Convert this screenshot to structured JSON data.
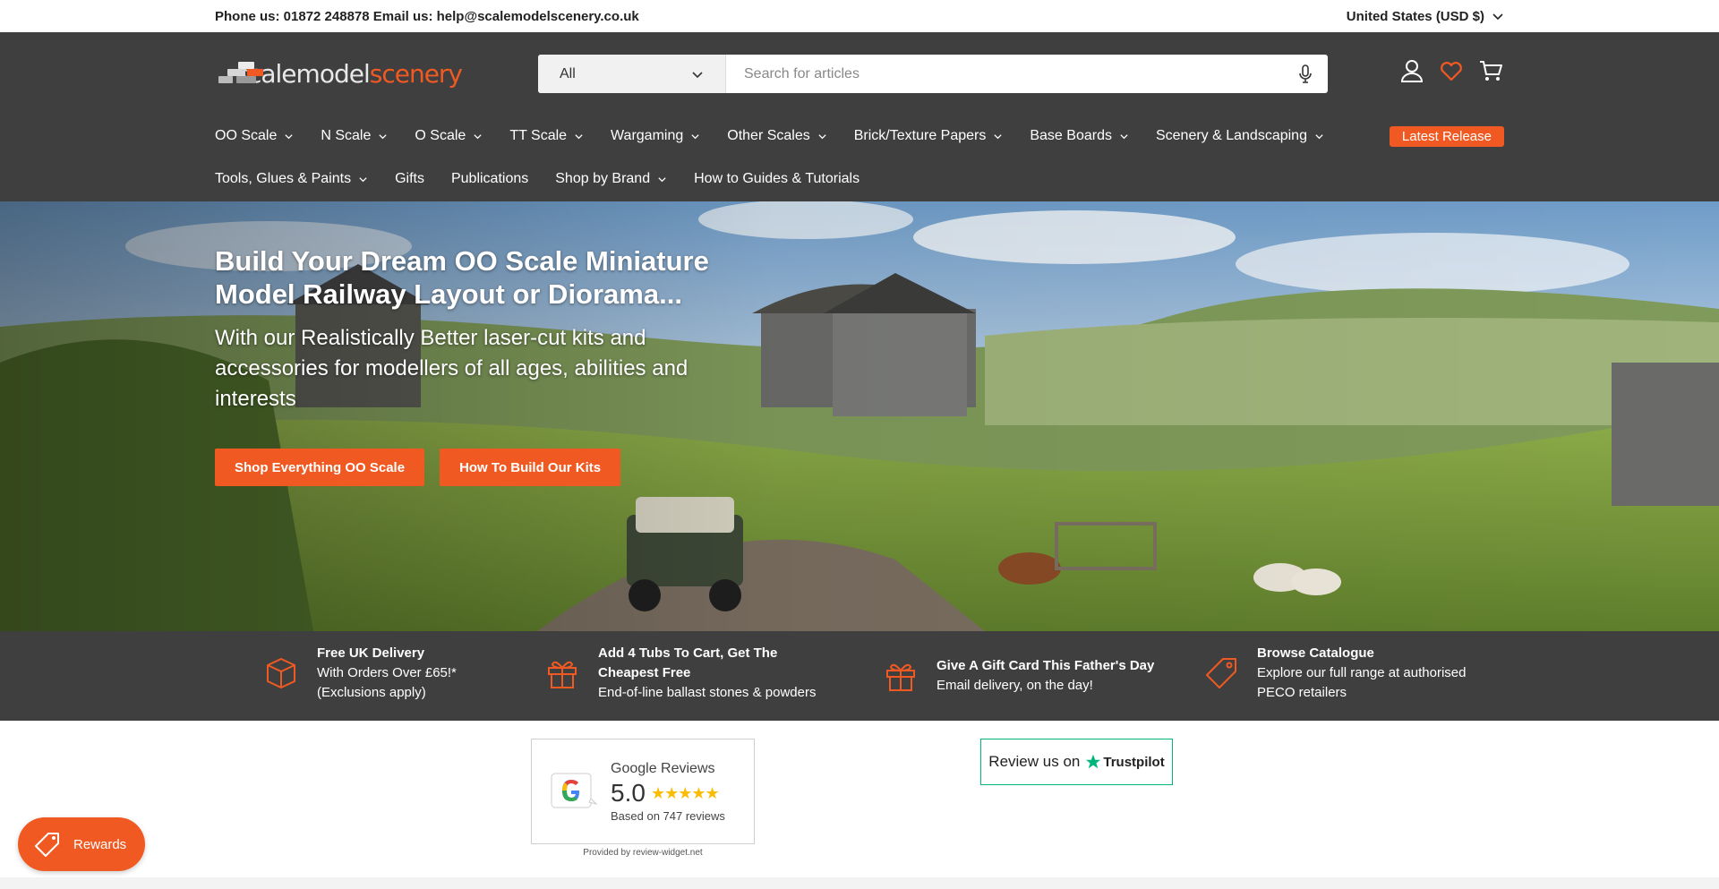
{
  "topbar": {
    "contact": "Phone us: 01872 248878 Email us: help@scalemodelscenery.co.uk",
    "currency": "United States (USD $)"
  },
  "header": {
    "logo_text_white": "scalemodel",
    "logo_text_orange": "scenery",
    "search_category": "All",
    "search_placeholder": "Search for articles"
  },
  "nav": {
    "row1": [
      {
        "label": "OO Scale",
        "dropdown": true
      },
      {
        "label": "N Scale",
        "dropdown": true
      },
      {
        "label": "O Scale",
        "dropdown": true
      },
      {
        "label": "TT Scale",
        "dropdown": true
      },
      {
        "label": "Wargaming",
        "dropdown": true
      },
      {
        "label": "Other Scales",
        "dropdown": true
      },
      {
        "label": "Brick/Texture Papers",
        "dropdown": true
      },
      {
        "label": "Base Boards",
        "dropdown": true
      },
      {
        "label": "Scenery & Landscaping",
        "dropdown": true
      }
    ],
    "latest": "Latest Release",
    "row2": [
      {
        "label": "Tools, Glues & Paints",
        "dropdown": true
      },
      {
        "label": "Gifts",
        "dropdown": false
      },
      {
        "label": "Publications",
        "dropdown": false
      },
      {
        "label": "Shop by Brand",
        "dropdown": true
      },
      {
        "label": "How to Guides & Tutorials",
        "dropdown": false
      }
    ]
  },
  "hero": {
    "title": "Build Your Dream OO Scale Miniature Model Railway Layout or Diorama...",
    "subtitle": "With our Realistically Better laser-cut kits and accessories for modellers of all ages, abilities and interests",
    "button1": "Shop Everything OO Scale",
    "button2": "How To Build Our Kits"
  },
  "usp": [
    {
      "icon": "box-icon",
      "title": "Free UK Delivery",
      "text": "With Orders Over £65!* (Exclusions apply)"
    },
    {
      "icon": "gift-icon",
      "title": "Add 4 Tubs To Cart, Get The Cheapest Free",
      "text": "End-of-line ballast stones & powders"
    },
    {
      "icon": "gift-icon",
      "title": "Give A Gift Card This Father's Day",
      "text": "Email delivery, on the day!"
    },
    {
      "icon": "tag-icon",
      "title": "Browse Catalogue",
      "text": "Explore our full range at authorised PECO retailers"
    }
  ],
  "reviews": {
    "google_title": "Google Reviews",
    "google_score": "5.0",
    "google_based": "Based on 747 reviews",
    "provided": "Provided by review-widget.net",
    "trustpilot_text": "Review us on",
    "trustpilot_brand": "Trustpilot"
  },
  "rewards": {
    "label": "Rewards"
  },
  "colors": {
    "accent": "#f05a22",
    "header_bg": "#3f3f3f",
    "trustpilot": "#00b67a",
    "star": "#fbbc05"
  }
}
